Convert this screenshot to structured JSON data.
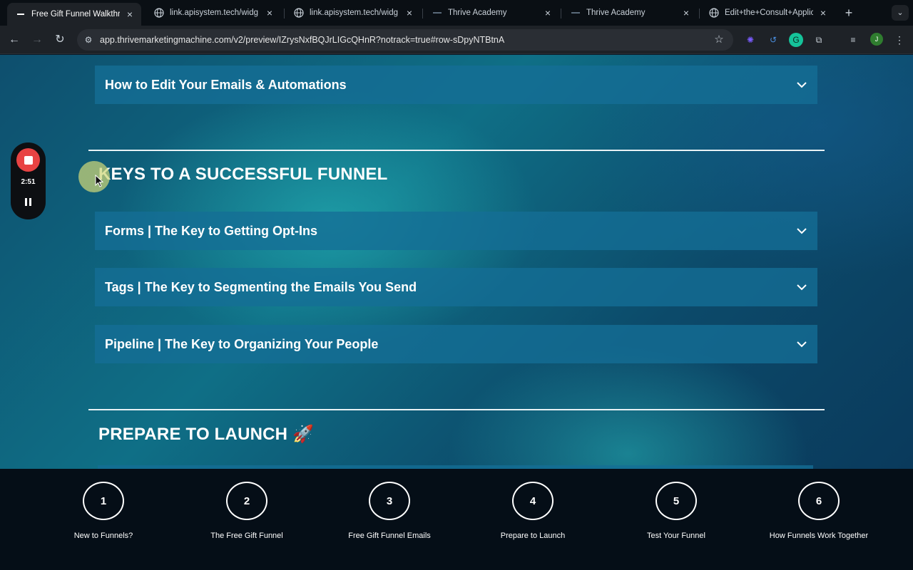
{
  "browser": {
    "tabs": [
      {
        "title": "Free Gift Funnel Walkthro",
        "active": true,
        "icon": "dash-icon"
      },
      {
        "title": "link.apisystem.tech/widg",
        "active": false,
        "icon": "globe-icon"
      },
      {
        "title": "link.apisystem.tech/widg",
        "active": false,
        "icon": "globe-icon"
      },
      {
        "title": "Thrive Academy",
        "active": false,
        "icon": "dash-icon"
      },
      {
        "title": "Thrive Academy",
        "active": false,
        "icon": "dash-icon"
      },
      {
        "title": "Edit+the+Consult+Applic",
        "active": false,
        "icon": "globe-icon"
      }
    ],
    "url": "app.thrivemarketingmachine.com/v2/preview/IZrysNxfBQJrLIGcQHnR?notrack=true#row-sDpyNTBtnA",
    "profile_initial": "J"
  },
  "recorder": {
    "time": "2:51"
  },
  "page": {
    "top_accordion": "How to Edit Your Emails & Automations",
    "section_keys": {
      "title": "KEYS TO A SUCCESSFUL FUNNEL",
      "items": [
        "Forms | The Key to Getting Opt-Ins",
        "Tags | The Key to Segmenting the Emails You Send",
        "Pipeline | The Key to Organizing Your People"
      ]
    },
    "section_launch": {
      "title": "PREPARE TO LAUNCH 🚀"
    }
  },
  "steps": [
    {
      "number": "1",
      "label": "New to Funnels?"
    },
    {
      "number": "2",
      "label": "The Free Gift Funnel"
    },
    {
      "number": "3",
      "label": "Free Gift Funnel Emails"
    },
    {
      "number": "4",
      "label": "Prepare to Launch"
    },
    {
      "number": "5",
      "label": "Test Your Funnel"
    },
    {
      "number": "6",
      "label": "How Funnels Work Together"
    }
  ],
  "colors": {
    "accordion_bg": "#146e96",
    "recorder_stop": "#e84343",
    "stepnav_bg": "#050e17"
  }
}
